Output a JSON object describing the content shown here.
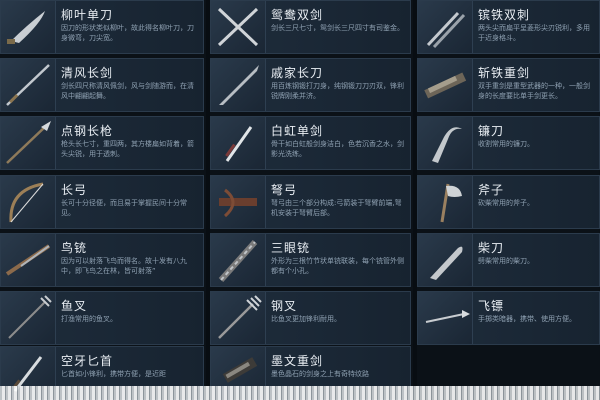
{
  "weapons": [
    {
      "name": "柳叶单刀",
      "desc": "因刀的形状类似柳叶，故此得名柳叶刀，刀身微弯，刀尖宽。",
      "icon": "saber-icon"
    },
    {
      "name": "鸳鸯双剑",
      "desc": "剑长三尺七寸，鸳剑长三尺四寸有司鉴金。",
      "icon": "twin-swords-icon"
    },
    {
      "name": "镔铁双刺",
      "desc": "两头尖而扁平呈菱形尖刃锐利，多用于近身格斗。",
      "icon": "twin-daggers-icon"
    },
    {
      "name": "清风长剑",
      "desc": "剑长四尺称清风佩剑，风与剑随游而，在清风中翩翩起舞。",
      "icon": "long-sword-icon"
    },
    {
      "name": "戚家长刀",
      "desc": "用百炼钢锻打刀身，纯钢锻刀刀刃双，锋利锐牌刚柔并济。",
      "icon": "long-saber-icon"
    },
    {
      "name": "斩铁重剑",
      "desc": "双手重剑是重型武器的一种，一般剑身的长度要比单手剑更长。",
      "icon": "heavy-sword-icon"
    },
    {
      "name": "点钢长枪",
      "desc": "枪头长七寸，重四两，其方楼扁如背着，箭头尖锐，用于透刺。",
      "icon": "spear-icon"
    },
    {
      "name": "白虹单剑",
      "desc": "骨干如白虹般剑身洁白，色若沉香之水，剑影光洗练。",
      "icon": "white-sword-icon"
    },
    {
      "name": "镰刀",
      "desc": "收割常用的镰刀。",
      "icon": "sickle-icon"
    },
    {
      "name": "长弓",
      "desc": "长可十分径便，而且易于掌握民间十分常见。",
      "icon": "longbow-icon"
    },
    {
      "name": "弩弓",
      "desc": "弩弓由三个部分构成:弓箭装于弩臂前端,弩机安装于弩臂后部。",
      "icon": "crossbow-icon"
    },
    {
      "name": "斧子",
      "desc": "砍柴常用的斧子。",
      "icon": "axe-icon"
    },
    {
      "name": "鸟铳",
      "desc": "因为可以射落飞鸟而得名。故十发有八九中，即飞鸟之在林，皆可射落”",
      "icon": "musket-icon"
    },
    {
      "name": "三眼铳",
      "desc": "外形为三根竹节状单铳联装，每个铳管外侧都有个小孔。",
      "icon": "three-barrel-gun-icon"
    },
    {
      "name": "柴刀",
      "desc": "劈柴常用的柴刀。",
      "icon": "machete-icon"
    },
    {
      "name": "鱼叉",
      "desc": "打渔常用的鱼叉。",
      "icon": "fishing-spear-icon"
    },
    {
      "name": "钢叉",
      "desc": "比鱼叉更加锋利耐用。",
      "icon": "trident-icon"
    },
    {
      "name": "飞镖",
      "desc": "手掷类暗器，携带、使用方便。",
      "icon": "dart-icon"
    },
    {
      "name": "空牙匕首",
      "desc": "匕首如小锋利，携带方便，是近距",
      "icon": "dagger-icon"
    },
    {
      "name": "墨文重剑",
      "desc": "墨色晶石的剑身之上有奇特纹路",
      "icon": "ink-heavy-sword-icon"
    }
  ]
}
